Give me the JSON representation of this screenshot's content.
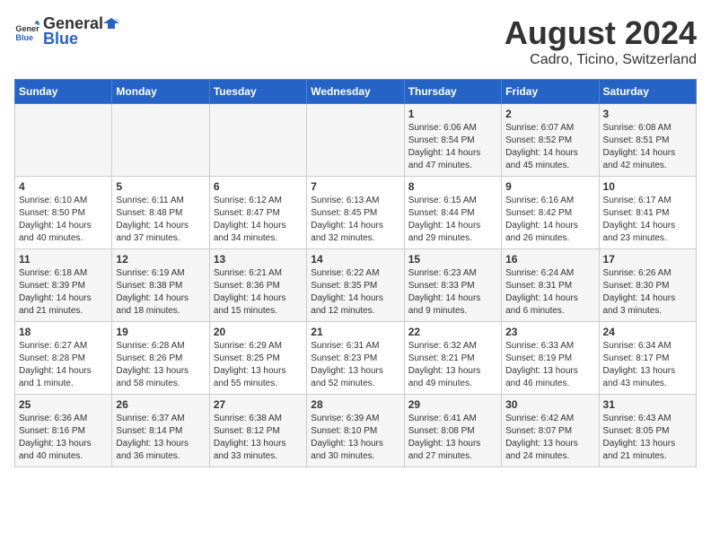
{
  "header": {
    "logo_general": "General",
    "logo_blue": "Blue",
    "month_year": "August 2024",
    "location": "Cadro, Ticino, Switzerland"
  },
  "calendar": {
    "days_of_week": [
      "Sunday",
      "Monday",
      "Tuesday",
      "Wednesday",
      "Thursday",
      "Friday",
      "Saturday"
    ],
    "weeks": [
      [
        {
          "day": "",
          "info": ""
        },
        {
          "day": "",
          "info": ""
        },
        {
          "day": "",
          "info": ""
        },
        {
          "day": "",
          "info": ""
        },
        {
          "day": "1",
          "info": "Sunrise: 6:06 AM\nSunset: 8:54 PM\nDaylight: 14 hours and 47 minutes."
        },
        {
          "day": "2",
          "info": "Sunrise: 6:07 AM\nSunset: 8:52 PM\nDaylight: 14 hours and 45 minutes."
        },
        {
          "day": "3",
          "info": "Sunrise: 6:08 AM\nSunset: 8:51 PM\nDaylight: 14 hours and 42 minutes."
        }
      ],
      [
        {
          "day": "4",
          "info": "Sunrise: 6:10 AM\nSunset: 8:50 PM\nDaylight: 14 hours and 40 minutes."
        },
        {
          "day": "5",
          "info": "Sunrise: 6:11 AM\nSunset: 8:48 PM\nDaylight: 14 hours and 37 minutes."
        },
        {
          "day": "6",
          "info": "Sunrise: 6:12 AM\nSunset: 8:47 PM\nDaylight: 14 hours and 34 minutes."
        },
        {
          "day": "7",
          "info": "Sunrise: 6:13 AM\nSunset: 8:45 PM\nDaylight: 14 hours and 32 minutes."
        },
        {
          "day": "8",
          "info": "Sunrise: 6:15 AM\nSunset: 8:44 PM\nDaylight: 14 hours and 29 minutes."
        },
        {
          "day": "9",
          "info": "Sunrise: 6:16 AM\nSunset: 8:42 PM\nDaylight: 14 hours and 26 minutes."
        },
        {
          "day": "10",
          "info": "Sunrise: 6:17 AM\nSunset: 8:41 PM\nDaylight: 14 hours and 23 minutes."
        }
      ],
      [
        {
          "day": "11",
          "info": "Sunrise: 6:18 AM\nSunset: 8:39 PM\nDaylight: 14 hours and 21 minutes."
        },
        {
          "day": "12",
          "info": "Sunrise: 6:19 AM\nSunset: 8:38 PM\nDaylight: 14 hours and 18 minutes."
        },
        {
          "day": "13",
          "info": "Sunrise: 6:21 AM\nSunset: 8:36 PM\nDaylight: 14 hours and 15 minutes."
        },
        {
          "day": "14",
          "info": "Sunrise: 6:22 AM\nSunset: 8:35 PM\nDaylight: 14 hours and 12 minutes."
        },
        {
          "day": "15",
          "info": "Sunrise: 6:23 AM\nSunset: 8:33 PM\nDaylight: 14 hours and 9 minutes."
        },
        {
          "day": "16",
          "info": "Sunrise: 6:24 AM\nSunset: 8:31 PM\nDaylight: 14 hours and 6 minutes."
        },
        {
          "day": "17",
          "info": "Sunrise: 6:26 AM\nSunset: 8:30 PM\nDaylight: 14 hours and 3 minutes."
        }
      ],
      [
        {
          "day": "18",
          "info": "Sunrise: 6:27 AM\nSunset: 8:28 PM\nDaylight: 14 hours and 1 minute."
        },
        {
          "day": "19",
          "info": "Sunrise: 6:28 AM\nSunset: 8:26 PM\nDaylight: 13 hours and 58 minutes."
        },
        {
          "day": "20",
          "info": "Sunrise: 6:29 AM\nSunset: 8:25 PM\nDaylight: 13 hours and 55 minutes."
        },
        {
          "day": "21",
          "info": "Sunrise: 6:31 AM\nSunset: 8:23 PM\nDaylight: 13 hours and 52 minutes."
        },
        {
          "day": "22",
          "info": "Sunrise: 6:32 AM\nSunset: 8:21 PM\nDaylight: 13 hours and 49 minutes."
        },
        {
          "day": "23",
          "info": "Sunrise: 6:33 AM\nSunset: 8:19 PM\nDaylight: 13 hours and 46 minutes."
        },
        {
          "day": "24",
          "info": "Sunrise: 6:34 AM\nSunset: 8:17 PM\nDaylight: 13 hours and 43 minutes."
        }
      ],
      [
        {
          "day": "25",
          "info": "Sunrise: 6:36 AM\nSunset: 8:16 PM\nDaylight: 13 hours and 40 minutes."
        },
        {
          "day": "26",
          "info": "Sunrise: 6:37 AM\nSunset: 8:14 PM\nDaylight: 13 hours and 36 minutes."
        },
        {
          "day": "27",
          "info": "Sunrise: 6:38 AM\nSunset: 8:12 PM\nDaylight: 13 hours and 33 minutes."
        },
        {
          "day": "28",
          "info": "Sunrise: 6:39 AM\nSunset: 8:10 PM\nDaylight: 13 hours and 30 minutes."
        },
        {
          "day": "29",
          "info": "Sunrise: 6:41 AM\nSunset: 8:08 PM\nDaylight: 13 hours and 27 minutes."
        },
        {
          "day": "30",
          "info": "Sunrise: 6:42 AM\nSunset: 8:07 PM\nDaylight: 13 hours and 24 minutes."
        },
        {
          "day": "31",
          "info": "Sunrise: 6:43 AM\nSunset: 8:05 PM\nDaylight: 13 hours and 21 minutes."
        }
      ]
    ]
  }
}
